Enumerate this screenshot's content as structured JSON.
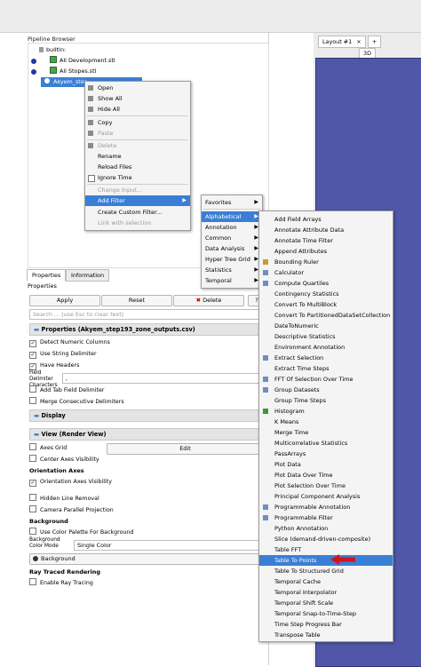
{
  "pipeline_browser": {
    "title": "Pipeline Browser",
    "items": [
      {
        "label": "builtin:"
      },
      {
        "label": "All Development.stl"
      },
      {
        "label": "All Stopes.stl"
      },
      {
        "label": "Akyem_step"
      }
    ]
  },
  "layout": {
    "tab_label": "Layout #1",
    "tab_close": "×",
    "add_tab": "+",
    "view_3d": "3D"
  },
  "context_menu": {
    "items": [
      {
        "label": "Open",
        "enabled": true
      },
      {
        "label": "Show All",
        "enabled": true
      },
      {
        "label": "Hide All",
        "enabled": true
      },
      {
        "label": "Copy",
        "enabled": true
      },
      {
        "label": "Paste",
        "enabled": false
      },
      {
        "label": "Delete",
        "enabled": false
      },
      {
        "label": "Rename",
        "enabled": true
      },
      {
        "label": "Reload Files",
        "enabled": true
      },
      {
        "label": "Ignore Time",
        "enabled": true
      },
      {
        "label": "Change Input...",
        "enabled": false
      },
      {
        "label": "Add Filter",
        "enabled": true
      },
      {
        "label": "Create Custom Filter...",
        "enabled": true
      },
      {
        "label": "Link with selection",
        "enabled": false
      }
    ]
  },
  "filter_categories": [
    "Favorites",
    "Alphabetical",
    "Annotation",
    "Common",
    "Data Analysis",
    "Hyper Tree Grid",
    "Statistics",
    "Temporal"
  ],
  "alphabetical_filters": [
    "Add Field Arrays",
    "Annotate Attribute Data",
    "Annotate Time Filter",
    "Append Attributes",
    "Bounding Ruler",
    "Calculator",
    "Compute Quartiles",
    "Contingency Statistics",
    "Convert To MultiBlock",
    "Convert To PartitionedDataSetCollection",
    "DateToNumeric",
    "Descriptive Statistics",
    "Environment Annotation",
    "Extract Selection",
    "Extract Time Steps",
    "FFT Of Selection Over Time",
    "Group Datasets",
    "Group Time Steps",
    "Histogram",
    "K Means",
    "Merge Time",
    "Multicorrelative Statistics",
    "PassArrays",
    "Plot Data",
    "Plot Data Over Time",
    "Plot Selection Over Time",
    "Principal Component Analysis",
    "Programmable Annotation",
    "Programmable Filter",
    "Python Annotation",
    "Slice (demand-driven-composite)",
    "Table FFT",
    "Table To Points",
    "Table To Structured Grid",
    "Temporal Cache",
    "Temporal Interpolator",
    "Temporal Shift Scale",
    "Temporal Snap-to-Time-Step",
    "Time Step Progress Bar",
    "Transpose Table"
  ],
  "properties": {
    "tabs": [
      "Properties",
      "Information"
    ],
    "label": "Properties",
    "apply": "Apply",
    "reset": "Reset",
    "delete": "Delete",
    "help": "?",
    "search_placeholder": "Search ... (use Esc to clear text)",
    "reader_section": "Properties (Akyem_step193_zone_outputs.csv)",
    "detect_numeric": "Detect Numeric Columns",
    "use_string_delimiter": "Use String Delimiter",
    "have_headers": "Have Headers",
    "field_delimiter_label": "Field Delimiter Characters",
    "field_delimiter_value": ",",
    "add_tab_delimiter": "Add Tab Field Delimiter",
    "merge_delimiters": "Merge Consecutive Delimiters",
    "display_section": "Display",
    "view_section": "View (Render View)",
    "axes_grid": "Axes Grid",
    "axes_grid_button": "Edit",
    "center_axes": "Center Axes Visibility",
    "orientation_head": "Orientation Axes",
    "orientation_visibility": "Orientation Axes Visibility",
    "hidden_line": "Hidden Line Removal",
    "camera_parallel": "Camera Parallel Projection",
    "background_head": "Background",
    "use_color_palette": "Use Color Palette For Background",
    "bg_color_mode_label": "Background Color Mode",
    "bg_color_mode_value": "Single Color",
    "background_button": "Background",
    "ray_traced_head": "Ray Traced Rendering",
    "enable_ray_tracing": "Enable Ray Tracing"
  },
  "colors": {
    "highlight": "#3a7fd6",
    "view_bg": "#5057a8",
    "arrow": "#d0161c"
  }
}
